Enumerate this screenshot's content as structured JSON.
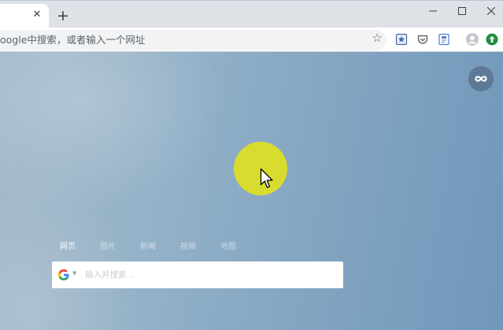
{
  "omnibox": {
    "placeholder": "oogle中搜索，或者输入一个网址"
  },
  "icons": {
    "close": "close-icon",
    "new_tab": "plus-icon",
    "minimize": "minimize-icon",
    "maximize": "maximize-icon",
    "window_close": "close-icon",
    "bookmark": "star-icon",
    "infinity": "infinity-icon",
    "search_engine": "google-icon",
    "cursor": "mouse-pointer-icon"
  },
  "search": {
    "tabs": [
      {
        "label": "网页",
        "active": true
      },
      {
        "label": "图片",
        "active": false
      },
      {
        "label": "新闻",
        "active": false
      },
      {
        "label": "视频",
        "active": false
      },
      {
        "label": "地图",
        "active": false
      }
    ],
    "placeholder": "输入并搜索..."
  },
  "colors": {
    "halo": "#d7dc2e",
    "ext_green": "#1e8e3e"
  }
}
